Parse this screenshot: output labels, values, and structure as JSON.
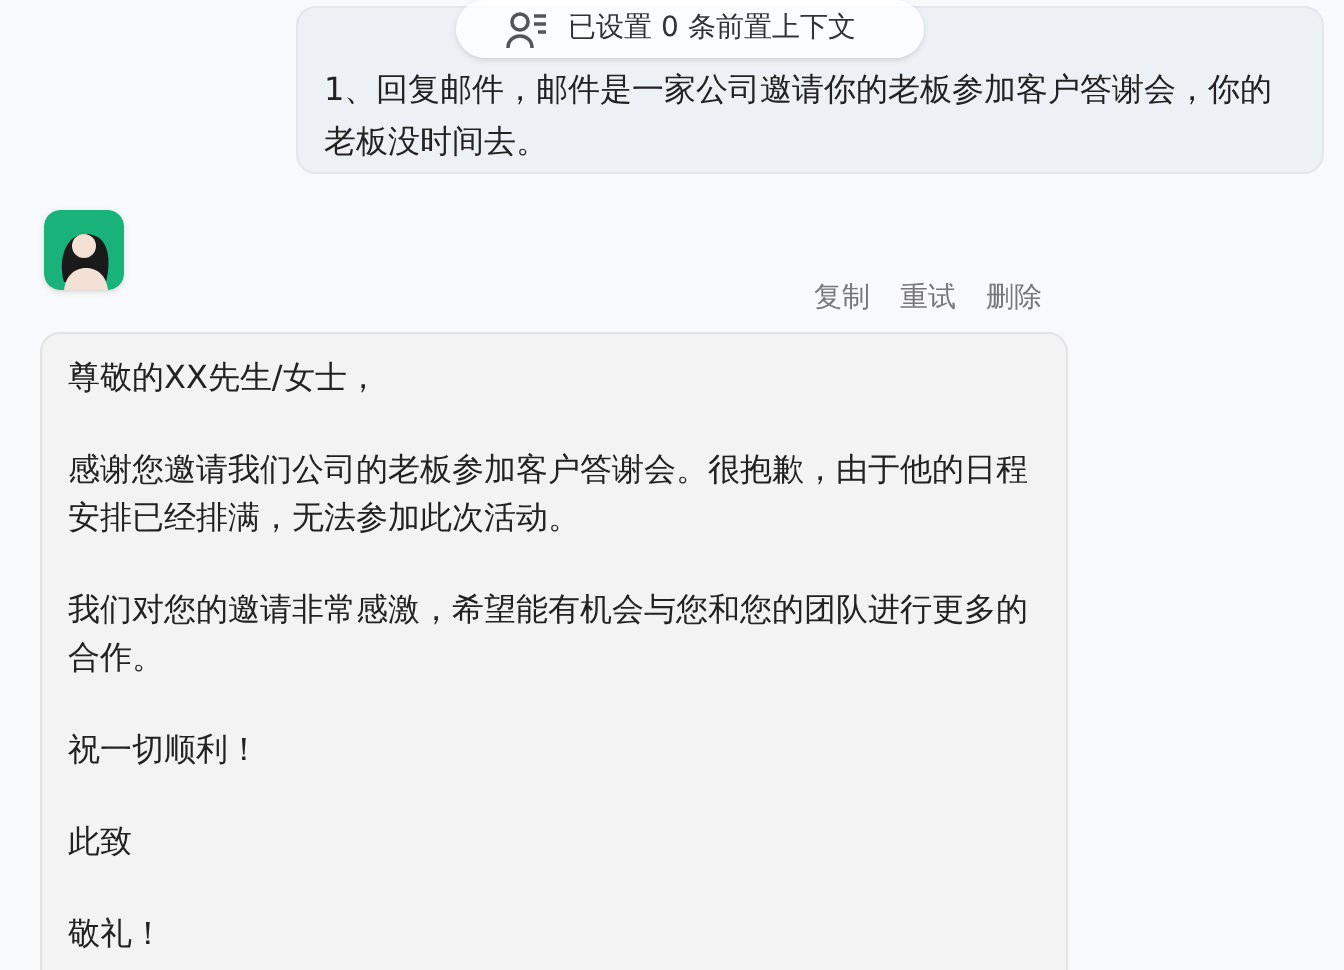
{
  "user_message": {
    "text": "1、回复邮件，邮件是一家公司邀请你的老板参加客户答谢会，你的老板没时间去。"
  },
  "context_pill": {
    "text": "已设置 0 条前置上下文"
  },
  "actions": [
    "复制",
    "重试",
    "删除"
  ],
  "reply": {
    "paragraphs": [
      "尊敬的XX先生/女士，",
      "感谢您邀请我们公司的老板参加客户答谢会。很抱歉，由于他的日程安排已经排满，无法参加此次活动。",
      "我们对您的邀请非常感激，希望能有机会与您和您的团队进行更多的合作。",
      "祝一切顺利！",
      "此致",
      "敬礼！"
    ]
  }
}
